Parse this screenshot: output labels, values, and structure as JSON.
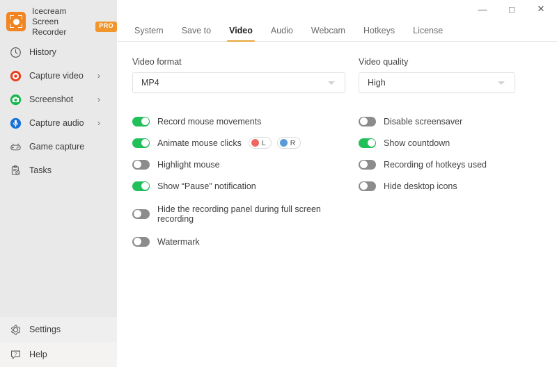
{
  "brand": {
    "logo_icon": "record-frame-icon",
    "line1": "Icecream",
    "line2": "Screen Recorder",
    "badge": "PRO",
    "badge_color": "#f0962a"
  },
  "sidebar": {
    "items": [
      {
        "label": "History",
        "icon": "clock-icon",
        "chevron": "",
        "selected": false
      },
      {
        "label": "Capture video",
        "icon": "record-icon",
        "chevron": "›",
        "selected": false
      },
      {
        "label": "Screenshot",
        "icon": "camera-icon",
        "chevron": "›",
        "selected": false
      },
      {
        "label": "Capture audio",
        "icon": "microphone-icon",
        "chevron": "›",
        "selected": false
      },
      {
        "label": "Game capture",
        "icon": "gamepad-icon",
        "chevron": "",
        "selected": false
      },
      {
        "label": "Tasks",
        "icon": "tasks-icon",
        "chevron": "",
        "selected": false
      }
    ],
    "bottom": [
      {
        "label": "Settings",
        "icon": "gear-icon",
        "active": true
      },
      {
        "label": "Help",
        "icon": "help-icon",
        "active": false
      }
    ]
  },
  "window_controls": {
    "minimize": "—",
    "maximize": "□",
    "close": "✕"
  },
  "tabs": [
    {
      "label": "System",
      "active": false
    },
    {
      "label": "Save to",
      "active": false
    },
    {
      "label": "Video",
      "active": true
    },
    {
      "label": "Audio",
      "active": false
    },
    {
      "label": "Webcam",
      "active": false
    },
    {
      "label": "Hotkeys",
      "active": false
    },
    {
      "label": "License",
      "active": false
    }
  ],
  "accent_color": "#e8a63a",
  "toggle_on_color": "#21c05a",
  "toggle_off_color": "#8c8c8c",
  "fields": {
    "video_format": {
      "label": "Video format",
      "value": "MP4"
    },
    "video_quality": {
      "label": "Video quality",
      "value": "High"
    }
  },
  "toggles_left": [
    {
      "label": "Record mouse movements",
      "on": true
    },
    {
      "label": "Animate mouse clicks",
      "on": true
    },
    {
      "label": "Highlight mouse",
      "on": false
    },
    {
      "label": "Show “Pause” notification",
      "on": true
    },
    {
      "label": "Hide the recording panel during full screen recording",
      "on": false
    },
    {
      "label": "Watermark",
      "on": false
    }
  ],
  "mouse_click_chips": [
    {
      "label": "L",
      "color": "#f0655f"
    },
    {
      "label": "R",
      "color": "#5b9bd5"
    }
  ],
  "toggles_right": [
    {
      "label": "Disable screensaver",
      "on": false
    },
    {
      "label": "Show countdown",
      "on": true
    },
    {
      "label": "Recording of hotkeys used",
      "on": false
    },
    {
      "label": "Hide desktop icons",
      "on": false
    }
  ]
}
